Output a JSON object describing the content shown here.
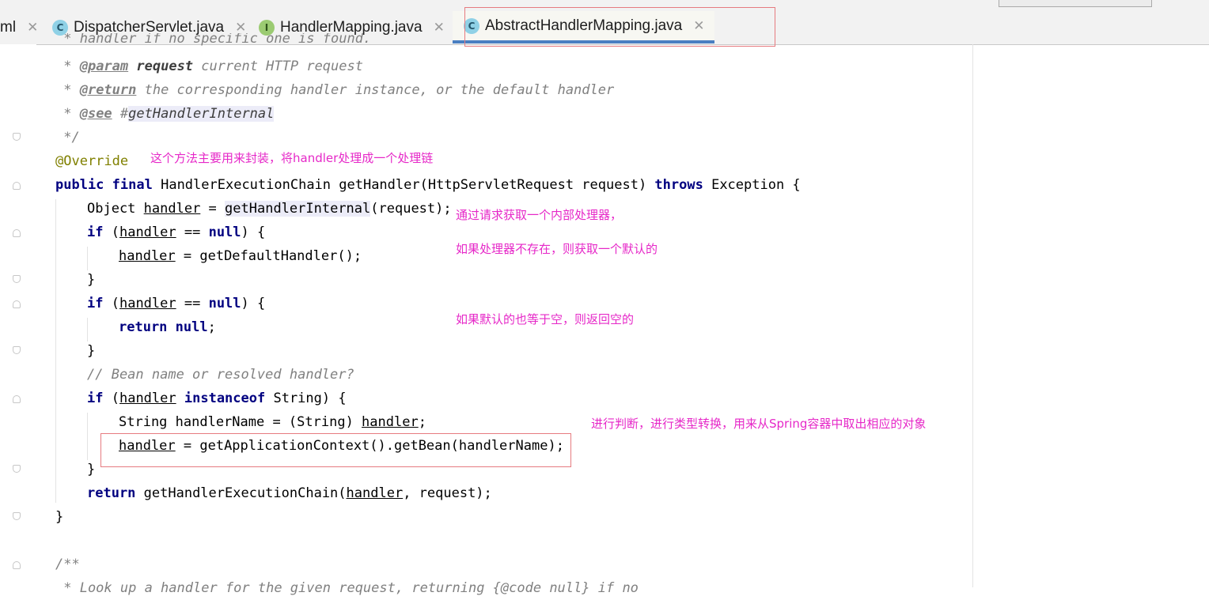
{
  "tabs": [
    {
      "label": "ml",
      "icon": "none",
      "active": false
    },
    {
      "label": "DispatcherServlet.java",
      "icon": "class-icon",
      "active": false
    },
    {
      "label": "HandlerMapping.java",
      "icon": "interface-icon",
      "active": false
    },
    {
      "label": "AbstractHandlerMapping.java",
      "icon": "class-icon",
      "active": true
    }
  ],
  "tab_icon_letters": {
    "class": "C",
    "interface": "I"
  },
  "close_glyph": "✕",
  "colors": {
    "keyword": "#000080",
    "comment": "#808080",
    "annotation": "#808000",
    "note": "#e628c8",
    "highlight_box": "#e67b80",
    "active_tab_underline": "#4a7fc1"
  },
  "code": {
    "cut_top": " * handler if no specific one is found.",
    "jd_param_star": " * ",
    "jd_param_tag": "@param",
    "jd_param_name": "request",
    "jd_param_desc": " current HTTP request",
    "jd_return_star": " * ",
    "jd_return_tag": "@return",
    "jd_return_desc": " the corresponding handler instance, or the default handler",
    "jd_see_star": " * ",
    "jd_see_tag": "@see",
    "jd_see_hash": " #",
    "jd_see_link": "getHandlerInternal",
    "jd_end": " */",
    "annotation": "@Override",
    "sig_kw1": "public",
    "sig_sp1": " ",
    "sig_kw2": "final",
    "sig_mid": " HandlerExecutionChain getHandler(HttpServletRequest request) ",
    "sig_kw3": "throws",
    "sig_end": " Exception {",
    "l1_a": "Object ",
    "l1_var": "handler",
    "l1_b": " = ",
    "l1_call": "getHandlerInternal",
    "l1_c": "(request);",
    "l2_kw": "if",
    "l2_a": " (",
    "l2_var": "handler",
    "l2_b": " == ",
    "l2_null": "null",
    "l2_c": ") {",
    "l3_var": "handler",
    "l3_b": " = getDefaultHandler();",
    "l4": "}",
    "l5_kw": "if",
    "l5_a": " (",
    "l5_var": "handler",
    "l5_b": " == ",
    "l5_null": "null",
    "l5_c": ") {",
    "l6_kw": "return",
    "l6_sp": " ",
    "l6_null": "null",
    "l6_end": ";",
    "l7": "}",
    "l8_comment": "// Bean name or resolved handler?",
    "l9_kw": "if",
    "l9_a": " (",
    "l9_var": "handler",
    "l9_sp": " ",
    "l9_kw2": "instanceof",
    "l9_b": " String) {",
    "l10_a": "String handlerName = (String) ",
    "l10_var": "handler",
    "l10_b": ";",
    "l11_var": "handler",
    "l11_b": " = getApplicationContext().getBean(handlerName);",
    "l12": "}",
    "l13_kw": "return",
    "l13_a": " getHandlerExecutionChain(",
    "l13_var": "handler",
    "l13_b": ", request);",
    "l14": "}",
    "l15": "/**",
    "l16": " * Look up a handler for the given request, returning {@code null} if no"
  },
  "notes": {
    "n1": "这个方法主要用来封装，将handler处理成一个处理链",
    "n2": "通过请求获取一个内部处理器，",
    "n3": "如果处理器不存在，则获取一个默认的",
    "n4": "如果默认的也等于空，则返回空的",
    "n5": "进行判断，进行类型转换，用来从Spring容器中取出相应的对象"
  }
}
